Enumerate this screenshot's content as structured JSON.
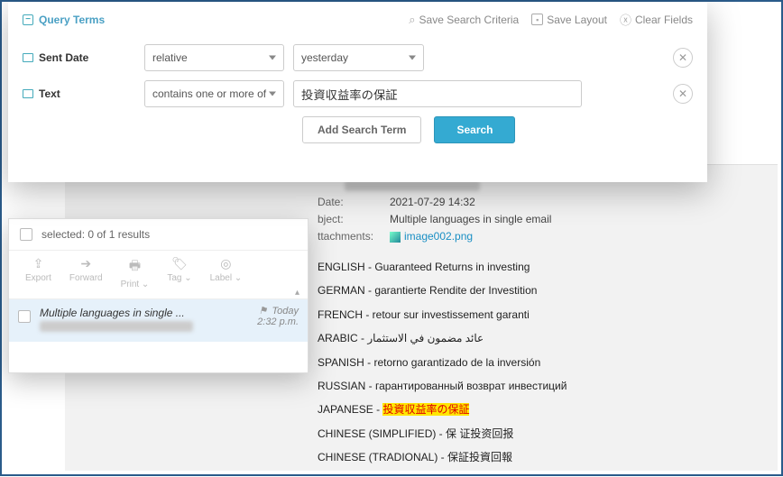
{
  "query_panel": {
    "title": "Query Terms",
    "actions": {
      "save_search": "Save Search Criteria",
      "save_layout": "Save Layout",
      "clear_fields": "Clear Fields"
    },
    "rows": [
      {
        "label": "Sent Date",
        "operator": "relative",
        "value": "yesterday",
        "value_type": "select"
      },
      {
        "label": "Text",
        "operator": "contains one or more of",
        "value": "投資収益率の保証",
        "value_type": "text"
      }
    ],
    "add_term_label": "Add Search Term",
    "search_label": "Search"
  },
  "results": {
    "selected_text": "selected: 0 of 1 results",
    "toolbar": [
      {
        "label": "Export",
        "icon": "⇪"
      },
      {
        "label": "Forward",
        "icon": "➔"
      },
      {
        "label": "Print ⌄",
        "icon": "🖶"
      },
      {
        "label": "Tag ⌄",
        "icon": "🏷"
      },
      {
        "label": "Label ⌄",
        "icon": "◎"
      }
    ],
    "row": {
      "subject": "Multiple languages in single ...",
      "day": "Today",
      "time": "2:32 p.m."
    }
  },
  "detail": {
    "date_label": "Date:",
    "date_value": "2021-07-29 14:32",
    "subject_label": "bject:",
    "subject_value": "Multiple languages in single email",
    "attach_label": "ttachments:",
    "attach_value": "image002.png",
    "body": [
      {
        "lang": "ENGLISH",
        "sep": "  -  ",
        "text": "Guaranteed Returns in investing"
      },
      {
        "lang": "GERMAN",
        "sep": "  -  ",
        "text": "garantierte Rendite der Investition"
      },
      {
        "lang": "FRENCH",
        "sep": " -  ",
        "text": "retour sur investissement garanti"
      },
      {
        "lang": "ARABIC",
        "sep": " - ",
        "text": "عائد مضمون في الاستثمار"
      },
      {
        "lang": "SPANISH",
        "sep": "  -  ",
        "text": "retorno garantizado de la inversión"
      },
      {
        "lang": "RUSSIAN",
        "sep": " - ",
        "text": "гарантированный возврат инвестиций"
      },
      {
        "lang": "JAPANESE",
        "sep": " - ",
        "text": "投資収益率の保証",
        "highlight": true
      },
      {
        "lang": "CHINESE (SIMPLIFIED)",
        "sep": " - ",
        "text": "保 证投资回报"
      },
      {
        "lang": "CHINESE (TRADIONAL)",
        "sep": " - ",
        "text": "保証投資回報"
      }
    ]
  }
}
